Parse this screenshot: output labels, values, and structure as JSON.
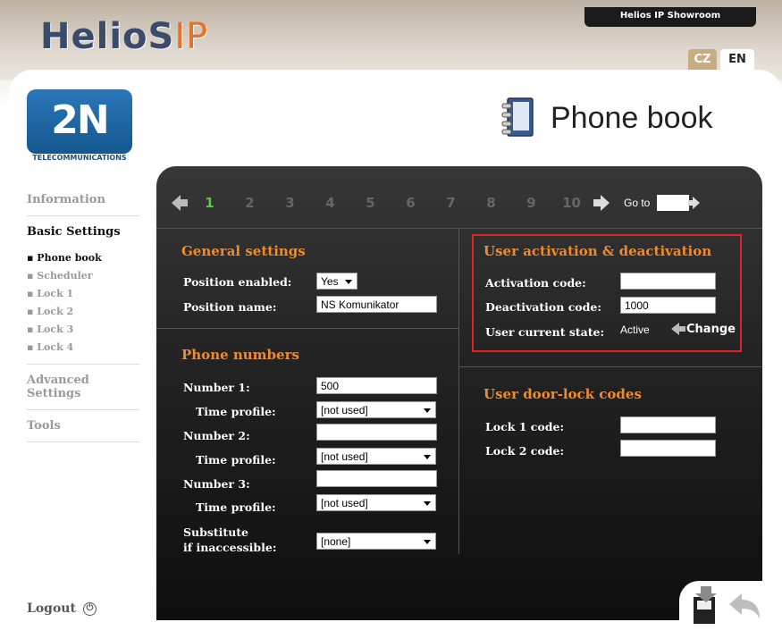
{
  "header": {
    "brand_main": "HelioS",
    "brand_ip": "IP",
    "showroom": "Helios IP Showroom",
    "lang_cz": "CZ",
    "lang_en": "EN"
  },
  "logo": {
    "mark": "2N",
    "sub": "TELECOMMUNICATIONS"
  },
  "page": {
    "title": "Phone book",
    "icon": "phone-book-icon"
  },
  "sidebar": {
    "items": [
      {
        "label": "Information"
      },
      {
        "label": "Basic Settings"
      },
      {
        "label": "Advanced Settings"
      },
      {
        "label": "Tools"
      }
    ],
    "subitems": [
      {
        "label": "Phone book"
      },
      {
        "label": "Scheduler"
      },
      {
        "label": "Lock 1"
      },
      {
        "label": "Lock 2"
      },
      {
        "label": "Lock 3"
      },
      {
        "label": "Lock 4"
      }
    ],
    "logout": "Logout"
  },
  "pager": {
    "pages": [
      "1",
      "2",
      "3",
      "4",
      "5",
      "6",
      "7",
      "8",
      "9",
      "10"
    ],
    "current": "1",
    "goto_label": "Go to"
  },
  "general": {
    "title": "General settings",
    "position_enabled_label": "Position enabled:",
    "position_enabled_value": "Yes",
    "position_name_label": "Position name:",
    "position_name_value": "NS Komunikator"
  },
  "phone_numbers": {
    "title": "Phone numbers",
    "number1_label": "Number 1:",
    "number1_value": "500",
    "time_profile_label": "Time profile:",
    "time_profile1_value": "[not used]",
    "number2_label": "Number 2:",
    "number2_value": "",
    "time_profile2_value": "[not used]",
    "number3_label": "Number 3:",
    "number3_value": "",
    "time_profile3_value": "[not used]",
    "substitute_label_1": "Substitute",
    "substitute_label_2": "if inaccessible:",
    "substitute_value": "[none]"
  },
  "activation": {
    "title": "User activation & deactivation",
    "activation_label": "Activation code:",
    "activation_value": "",
    "deactivation_label": "Deactivation code:",
    "deactivation_value": "1000",
    "state_label": "User current state:",
    "state_value": "Active",
    "change_label": "Change"
  },
  "door_lock": {
    "title": "User door-lock codes",
    "lock1_label": "Lock 1 code:",
    "lock1_value": "",
    "lock2_label": "Lock 2 code:",
    "lock2_value": ""
  },
  "colors": {
    "accent_orange": "#f08a2a",
    "current_page_green": "#4fd13a",
    "highlight_red": "#e0232b"
  }
}
